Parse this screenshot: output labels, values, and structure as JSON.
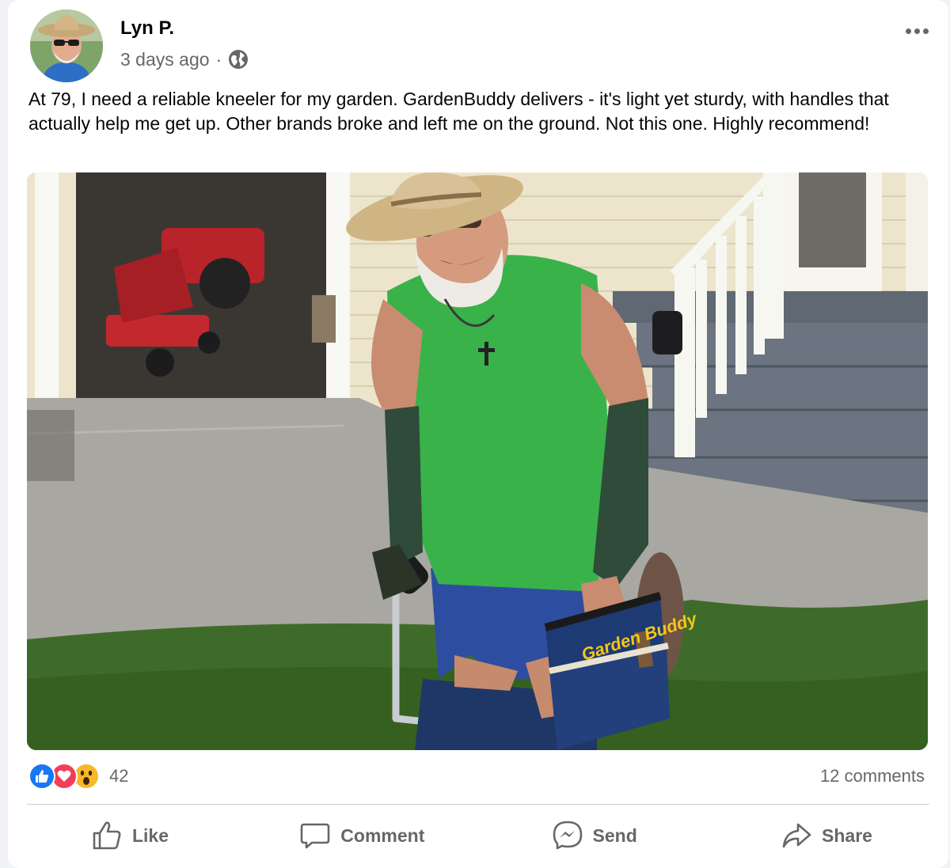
{
  "post": {
    "author": "Lyn P.",
    "timestamp": "3 days ago",
    "separator": "·",
    "privacy_icon": "globe-icon",
    "text": "At 79, I need a reliable kneeler for my garden. GardenBuddy delivers - it's light yet sturdy, with handles that actually help me get up. Other brands broke and left me on the ground. Not this one. Highly recommend!",
    "photo_brand_text": "Garden Buddy"
  },
  "reactions": {
    "icons": [
      "like-icon",
      "love-icon",
      "wow-icon"
    ],
    "count": "42"
  },
  "comments": {
    "count_label": "12 comments"
  },
  "actions": {
    "like": "Like",
    "comment": "Comment",
    "send": "Send",
    "share": "Share"
  },
  "colors": {
    "like_blue": "#1877f2",
    "love_red": "#f33e58",
    "wow_yellow": "#f7b928",
    "secondary_text": "#65676b"
  }
}
